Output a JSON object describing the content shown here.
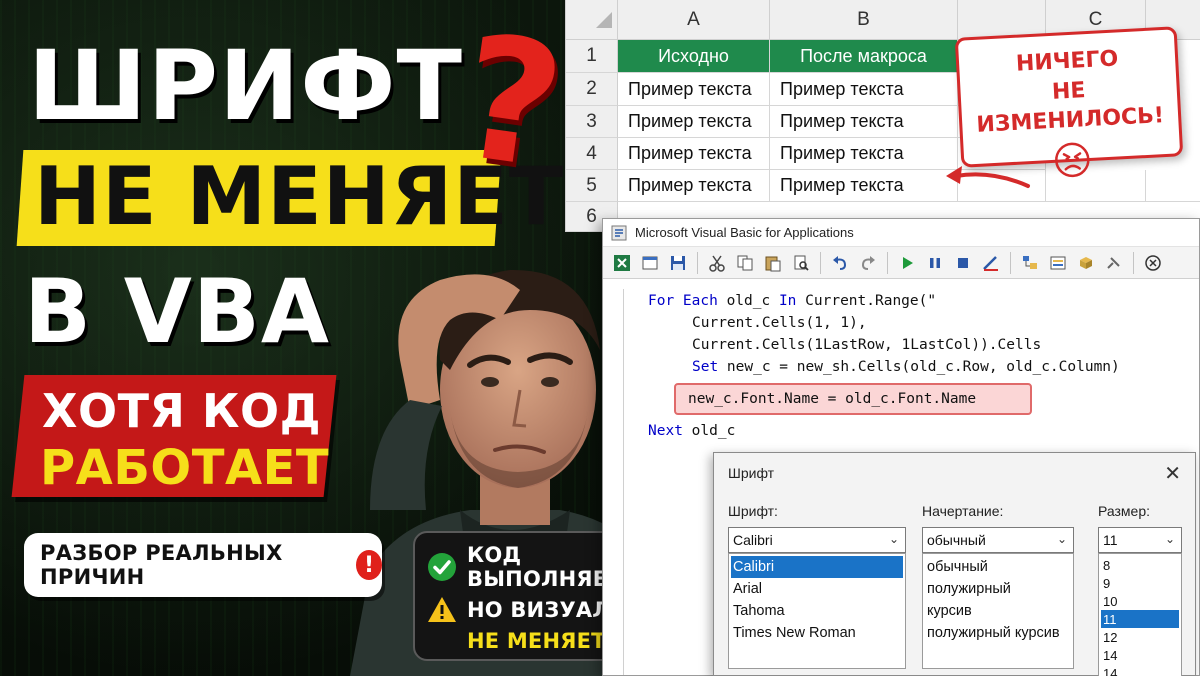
{
  "thumbnail": {
    "title_line1": "ШРИФТ",
    "title_line2": "НЕ МЕНЯЕТСЯ",
    "title_line3": "В VBA",
    "question_mark": "?",
    "banner_line1": "ХОТЯ КОД",
    "banner_line2": "РАБОТАЕТ",
    "pill_text": "РАЗБОР РЕАЛЬНЫХ ПРИЧИН",
    "pill_icon": "!",
    "status_lines": [
      "КОД ВЫПОЛНЯЕТСЯ",
      "НО ВИЗУАЛЬНО",
      "НЕ МЕНЯЕТСЯ"
    ],
    "status_icons": [
      "check-circle-icon",
      "warning-triangle-icon"
    ]
  },
  "excel": {
    "columns": [
      "A",
      "B",
      "C"
    ],
    "rows": [
      "1",
      "2",
      "3",
      "4",
      "5",
      "6"
    ],
    "header_cells": [
      "Исходно",
      "После макроса"
    ],
    "data_rows": [
      [
        "Пример текста",
        "Пример текста"
      ],
      [
        "Пример текста",
        "Пример текста"
      ],
      [
        "Пример текста",
        "Пример текста"
      ],
      [
        "Пример текста",
        "Пример текста"
      ]
    ],
    "header_color": "#1f8a4c"
  },
  "note": {
    "line1": "НИЧЕГО",
    "line2": "НЕ ИЗМЕНИЛОСЬ!",
    "color": "#d42a2a"
  },
  "vba": {
    "window_title": "Microsoft Visual Basic for Applications",
    "code": {
      "l1_kw1": "For Each",
      "l1_mid": " old_c ",
      "l1_kw2": "In",
      "l1_rest": " Current.Range(\"",
      "l2": "Current.Cells(1, 1),",
      "l3": "Current.Cells(1LastRow, 1LastCol)).Cells",
      "l4_kw": "Set",
      "l4_rest": " new_c = new_sh.Cells(old_c.Row, old_c.Column)",
      "l5": "new_c.Font.Name = old_c.Font.Name",
      "l6_kw": "Next",
      "l6_rest": " old_c"
    }
  },
  "font_dialog": {
    "title": "Шрифт",
    "close": "✕",
    "font_label": "Шрифт:",
    "style_label": "Начертание:",
    "size_label": "Размер:",
    "font_value": "Calibri",
    "style_value": "обычный",
    "size_value": "11",
    "fonts": [
      "Calibri",
      "Arial",
      "Tahoma",
      "Times New Roman"
    ],
    "styles": [
      "обычный",
      "полужирный",
      "курсив",
      "полужирный курсив"
    ],
    "sizes": [
      "8",
      "9",
      "10",
      "11",
      "12",
      "14",
      "14"
    ],
    "selected_font": "Calibri",
    "selected_size": "11"
  }
}
